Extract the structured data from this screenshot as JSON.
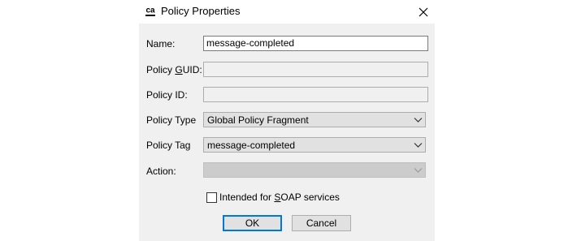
{
  "window": {
    "title": "Policy Properties",
    "app_icon_text": "ca"
  },
  "form": {
    "name": {
      "label_pre": "Name:",
      "value": "message-completed"
    },
    "policy_guid": {
      "label_pre": "Policy ",
      "label_ul": "G",
      "label_post": "UID:",
      "value": ""
    },
    "policy_id": {
      "label_pre": "Policy ID:",
      "value": ""
    },
    "policy_type": {
      "label_pre": "Policy Type",
      "value": "Global Policy Fragment"
    },
    "policy_tag": {
      "label_pre": "Policy Tag",
      "value": "message-completed"
    },
    "action": {
      "label_pre": "Action:",
      "value": ""
    },
    "soap_checkbox": {
      "label_pre": "Intended for ",
      "label_ul": "S",
      "label_post": "OAP services",
      "checked": false
    }
  },
  "buttons": {
    "ok_label": "OK",
    "cancel_label": "Cancel"
  },
  "icons": {
    "app": "ca-logo-icon",
    "close": "close-icon",
    "dropdown": "chevron-down-icon"
  },
  "colors": {
    "dialog_bg": "#f0f0f0",
    "default_button_border": "#0078d7"
  }
}
